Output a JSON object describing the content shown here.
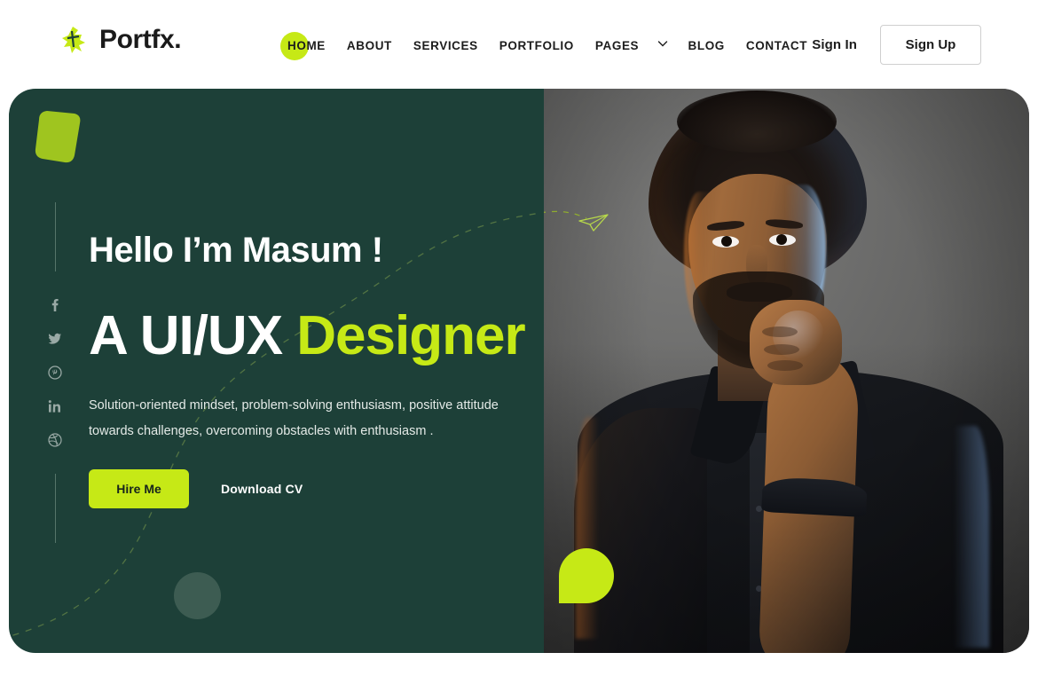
{
  "brand": {
    "name": "Portfx.",
    "mark_icon": "portfx-logo-icon"
  },
  "nav": {
    "items": [
      {
        "label": "HOME",
        "active": true
      },
      {
        "label": "ABOUT",
        "active": false
      },
      {
        "label": "SERVICES",
        "active": false
      },
      {
        "label": "PORTFOLIO",
        "active": false
      },
      {
        "label": "PAGES",
        "active": false,
        "has_dropdown": true,
        "caret_icon": "chevron-down-icon"
      },
      {
        "label": "BLOG",
        "active": false
      },
      {
        "label": "CONTACT",
        "active": false
      }
    ]
  },
  "auth": {
    "sign_in": "Sign In",
    "sign_up": "Sign Up"
  },
  "hero": {
    "greeting": "Hello I’m Masum !",
    "headline_plain": "A UI/UX ",
    "headline_accent": "Designer",
    "subtext": "Solution-oriented mindset, problem-solving enthusiasm, positive attitude towards challenges, overcoming obstacles with enthusiasm .",
    "primary_cta": "Hire Me",
    "secondary_cta": "Download CV",
    "portrait_alt": "Portrait of a bearded man in a black shirt resting his fist under his chin against a grey studio backdrop"
  },
  "social": {
    "items": [
      {
        "name": "facebook-icon"
      },
      {
        "name": "twitter-icon"
      },
      {
        "name": "pinterest-icon"
      },
      {
        "name": "linkedin-icon"
      },
      {
        "name": "dribbble-icon"
      }
    ]
  },
  "decor": {
    "paper_plane_icon": "paper-plane-icon",
    "dashed_curve": "dashed-curve-decoration",
    "blob_top_left": "green-blob-shape",
    "leaf_bottom": "green-leaf-shape",
    "circle": "dark-circle-shape"
  },
  "colors": {
    "accent_green": "#c6e916",
    "hero_dark_green": "#1d4038",
    "text_dark": "#1c1c1c",
    "white": "#ffffff",
    "border_grey": "#cfcfcf"
  }
}
